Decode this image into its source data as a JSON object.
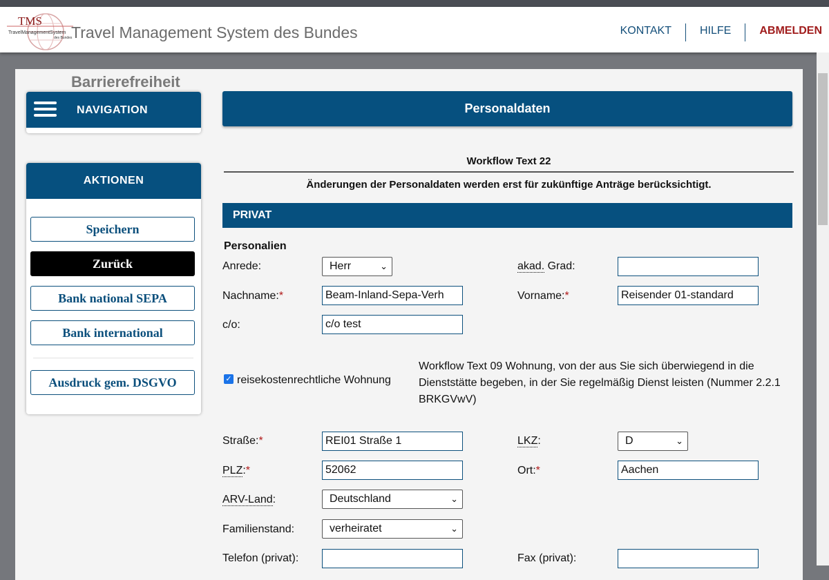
{
  "header": {
    "logo_text": "TMS",
    "logo_sub": "TravelManagementSystem des Bundes",
    "app_title": "Travel Management System des Bundes",
    "nav": {
      "kontakt": "KONTAKT",
      "hilfe": "HILFE",
      "abmelden": "ABMELDEN"
    }
  },
  "sidebar": {
    "barrier_label": "Barrierefreiheit",
    "navigation_label": "NAVIGATION",
    "actions_label": "AKTIONEN",
    "actions": {
      "save": "Speichern",
      "back": "Zurück",
      "bank_national": "Bank national SEPA",
      "bank_international": "Bank international",
      "print_dsgvo": "Ausdruck gem. DSGVO"
    }
  },
  "main": {
    "title": "Personaldaten",
    "workflow_text_22": "Workflow Text 22",
    "notice": "Änderungen der Personaldaten werden erst für zukünftige Anträge berücksichtigt.",
    "section_private": "PRIVAT",
    "subheading": "Personalien",
    "workflow_text_09": "Workflow Text 09 Wohnung, von der aus Sie sich überwiegend in die Dienststätte begeben, in der Sie regelmäßig Dienst leisten (Nummer 2.2.1 BRKGVwV)",
    "fields": {
      "anrede": {
        "label": "Anrede:",
        "value": "Herr"
      },
      "akad_grad": {
        "label_abbr": "akad.",
        "label_rest": " Grad:",
        "value": ""
      },
      "nachname": {
        "label": "Nachname:",
        "required": "*",
        "value": "Beam-Inland-Sepa-Verh"
      },
      "vorname": {
        "label": "Vorname:",
        "required": "*",
        "value": "Reisender 01-standard"
      },
      "co": {
        "label": "c/o:",
        "value": "c/o test"
      },
      "wohnung": {
        "label": "reisekostenrechtliche Wohnung",
        "checked": true
      },
      "strasse": {
        "label": "Straße:",
        "required": "*",
        "value": "REI01 Straße 1"
      },
      "lkz": {
        "label": "LKZ",
        "label_suffix": ":",
        "value": "D"
      },
      "plz": {
        "label": "PLZ",
        "label_suffix": ":",
        "required": "*",
        "value": "52062"
      },
      "ort": {
        "label": "Ort:",
        "required": "*",
        "value": "Aachen"
      },
      "arv_land": {
        "label": "ARV-Land",
        "label_suffix": ":",
        "value": "Deutschland"
      },
      "familienstand": {
        "label": "Familienstand:",
        "value": "verheiratet"
      },
      "telefon": {
        "label": "Telefon (privat):",
        "value": ""
      },
      "fax": {
        "label": "Fax (privat):",
        "value": ""
      }
    }
  },
  "colors": {
    "primary": "#06507f",
    "danger": "#a01c1c",
    "checkbox": "#1a73e8"
  }
}
